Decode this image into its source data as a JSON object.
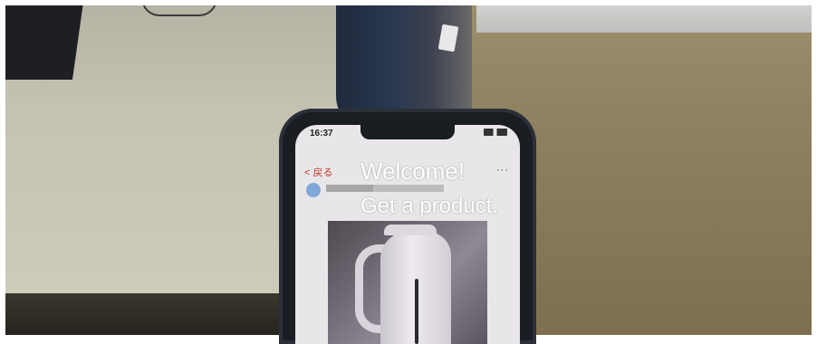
{
  "overlay": {
    "welcome": "Welcome!",
    "prompt": "Get a product."
  },
  "phone_screen": {
    "status_time": "16:37",
    "back_link": "< 戻る",
    "more": "···"
  }
}
